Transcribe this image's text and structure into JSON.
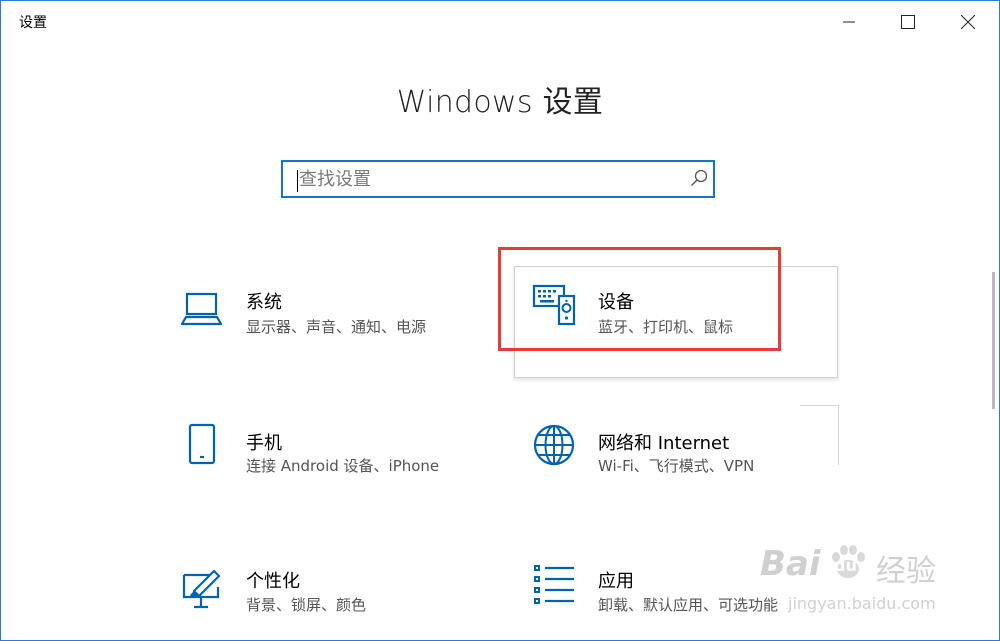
{
  "window": {
    "title": "设置"
  },
  "header": {
    "title": "Windows 设置"
  },
  "search": {
    "placeholder": "查找设置",
    "value": ""
  },
  "tiles": [
    {
      "title": "系统",
      "desc": "显示器、声音、通知、电源",
      "icon": "laptop-icon"
    },
    {
      "title": "设备",
      "desc": "蓝牙、打印机、鼠标",
      "icon": "devices-icon"
    },
    {
      "title": "手机",
      "desc": "连接 Android 设备、iPhone",
      "icon": "phone-icon"
    },
    {
      "title": "网络和 Internet",
      "desc": "Wi-Fi、飞行模式、VPN",
      "icon": "globe-icon"
    },
    {
      "title": "个性化",
      "desc": "背景、锁屏、颜色",
      "icon": "personalization-icon"
    },
    {
      "title": "应用",
      "desc": "卸载、默认应用、可选功能",
      "icon": "apps-list-icon"
    }
  ],
  "watermark": {
    "brand": "Bai",
    "brand2": "du",
    "product": "经验",
    "url": "jingyan.baidu.com"
  },
  "colors": {
    "accent": "#1574c9",
    "icon": "#0063b1",
    "highlight": "#e53b3b"
  }
}
